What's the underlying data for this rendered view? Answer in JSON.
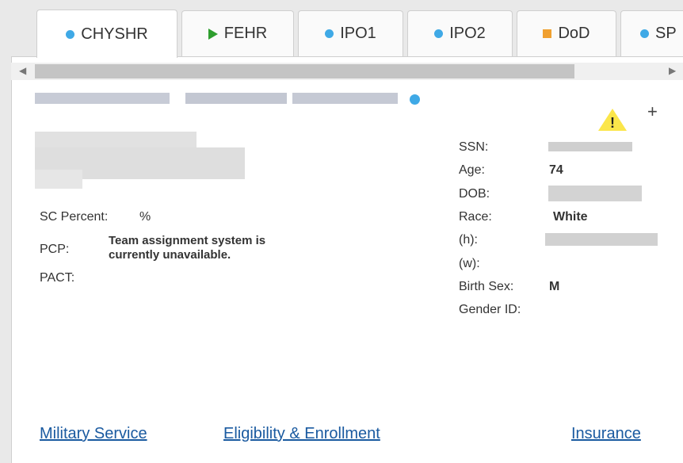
{
  "tabs": [
    {
      "label": "CHYSHR",
      "icon": "dot-icon",
      "color": "#3fa9e6",
      "active": true
    },
    {
      "label": "FEHR",
      "icon": "play-icon",
      "color": "#2e9e2e",
      "active": false
    },
    {
      "label": "IPO1",
      "icon": "dot-icon",
      "color": "#3fa9e6",
      "active": false
    },
    {
      "label": "IPO2",
      "icon": "dot-icon",
      "color": "#3fa9e6",
      "active": false
    },
    {
      "label": "DoD",
      "icon": "square-icon",
      "color": "#f0a030",
      "active": false
    },
    {
      "label": "SP",
      "icon": "dot-icon",
      "color": "#3fa9e6",
      "active": false
    }
  ],
  "scrollbar": {
    "left_arrow": "◀",
    "right_arrow": "▶"
  },
  "header": {
    "plus": "+",
    "warning": "!"
  },
  "left_details": {
    "sc_percent_label": "SC Percent:",
    "sc_percent_value": "%",
    "pcp_label": "PCP:",
    "pcp_value_line1": "Team assignment system is",
    "pcp_value_line2": "currently unavailable.",
    "pact_label": "PACT:"
  },
  "demographics": {
    "ssn_label": "SSN:",
    "age_label": "Age:",
    "age_value": "74",
    "dob_label": "DOB:",
    "race_label": "Race:",
    "race_value": "White",
    "phone_home_label": "(h):",
    "phone_work_label": "(w):",
    "birth_sex_label": "Birth Sex:",
    "birth_sex_value": "M",
    "gender_id_label": "Gender ID:"
  },
  "links": {
    "military": "Military Service",
    "eligibility": "Eligibility & Enrollment",
    "insurance": "Insurance"
  }
}
